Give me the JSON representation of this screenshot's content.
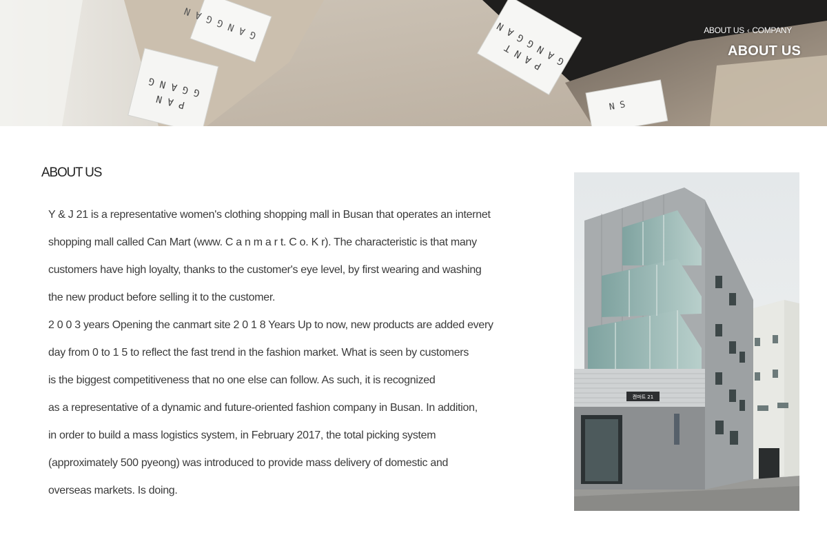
{
  "hero": {
    "breadcrumb": {
      "current": "ABOUT US",
      "separator": "‹",
      "parent": "COMPANY"
    },
    "title": "ABOUT US",
    "tag_texts": {
      "tag1": "GANGGAN TS",
      "tag2": "GGANG PAN",
      "tag3": "M.GANGGAN PANT",
      "tag4": "SN"
    }
  },
  "content": {
    "section_title": "ABOUT US",
    "paragraph_lines": [
      "Y & J 21 is a representative women's clothing shopping mall in Busan that operates an internet",
      "shopping mall called Can Mart  (www. C a n m a r t. C o. K r).  The characteristic is that many",
      "customers have high loyalty, thanks to the customer's eye level, by first wearing and washing",
      "the new product before selling it to the customer.",
      "2 0 0 3 years Opening the canmart site 2 0 1 8 Years Up to now, new products are added every",
      "day from 0 to 1 5 to reflect the fast trend in the fashion market. What is seen by customers",
      "is the biggest competitiveness that no one else can follow. As such, it is recognized",
      "as a representative of a dynamic and future-oriented fashion company in Busan. In addition,",
      "in order to build a mass logistics system, in February 2017, the total picking system",
      "(approximately 500 pyeong)  was introduced to provide mass delivery of domestic and",
      "overseas markets. Is doing."
    ],
    "building_sign": "캔마트 21"
  },
  "colors": {
    "text": "#3a3a3a",
    "heading": "#222222",
    "hero_text": "#ffffff"
  }
}
